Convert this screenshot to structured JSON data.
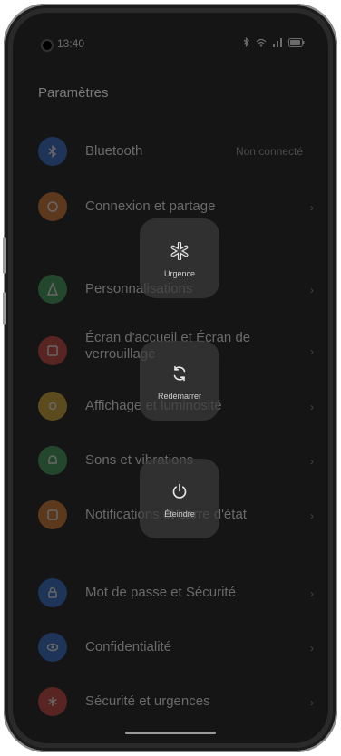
{
  "status_bar": {
    "time": "13:40",
    "icons": [
      "bluetooth-icon",
      "wifi-icon",
      "signal-icon",
      "battery-icon"
    ]
  },
  "settings": {
    "title": "Paramètres",
    "items": [
      {
        "label": "Bluetooth",
        "value": "Non connecté",
        "icon": "bluetooth-icon",
        "color": "#2f6fd6"
      },
      {
        "label": "Connexion et partage",
        "icon": "share-icon",
        "color": "#e07a2e"
      },
      {
        "label": "Personnalisations",
        "icon": "brush-icon",
        "color": "#3da55a"
      },
      {
        "label": "Écran d'accueil et Écran de verrouillage",
        "icon": "home-screen-icon",
        "color": "#d6453d"
      },
      {
        "label": "Affichage et luminosité",
        "icon": "sun-icon",
        "color": "#e0b12e"
      },
      {
        "label": "Sons et vibrations",
        "icon": "bell-icon",
        "color": "#3da55a"
      },
      {
        "label": "Notifications et barre d'état",
        "icon": "notification-icon",
        "color": "#e07a2e"
      },
      {
        "label": "Mot de passe et Sécurité",
        "icon": "lock-icon",
        "color": "#2f6fd6"
      },
      {
        "label": "Confidentialité",
        "icon": "privacy-icon",
        "color": "#2f6fd6"
      },
      {
        "label": "Sécurité et urgences",
        "icon": "emergency-icon",
        "color": "#d6453d"
      }
    ]
  },
  "power_menu": {
    "emergency": "Urgence",
    "restart": "Redémarrer",
    "power_off": "Éteindre"
  }
}
